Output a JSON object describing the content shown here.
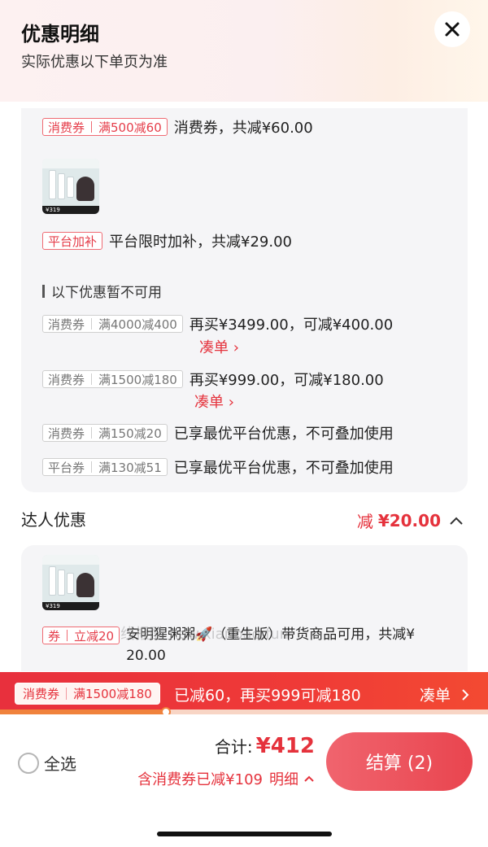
{
  "header": {
    "title": "优惠明细",
    "subtitle": "实际优惠以下单页为准",
    "close_icon": "close-icon"
  },
  "available": {
    "coupon1": {
      "type": "消费券",
      "rule": "满500减60",
      "text": "消费券，共减¥60.00"
    },
    "product_thumb_price": "¥319",
    "coupon2": {
      "type": "平台加补",
      "text": "平台限时加补，共减¥29.00"
    }
  },
  "unavailable": {
    "heading": "以下优惠暂不可用",
    "items": [
      {
        "type": "消费券",
        "rule": "满4000减400",
        "text": "再买¥3499.00，可减¥400.00",
        "link": "凑单"
      },
      {
        "type": "消费券",
        "rule": "满1500减180",
        "text": "再买¥999.00，可减¥180.00",
        "link": "凑单"
      },
      {
        "type": "消费券",
        "rule": "满150减20",
        "text": "已享最优平台优惠，不可叠加使用"
      },
      {
        "type": "平台券",
        "rule": "满130减51",
        "text": "已享最优平台优惠，不可叠加使用"
      }
    ]
  },
  "influencer": {
    "title": "达人优惠",
    "amount_label": "减",
    "amount": "¥20.00",
    "coupon": {
      "type": "券",
      "rule": "立减20",
      "text_line1": "安明猩粥粥🚀（重生版）带货商品可用，共减¥",
      "text_line2": "20.00"
    },
    "product_thumb_price": "¥319"
  },
  "watermark": "线报酷 new.xianbao.fun",
  "banner": {
    "type": "消费券",
    "rule": "满1500减180",
    "text": "已减60，再买999可减180",
    "link": "凑单",
    "progress": 0.34
  },
  "footer": {
    "select_all": "全选",
    "total_label": "合计:",
    "total_value": "¥412",
    "saved_text": "含消费券已减¥109",
    "detail_link": "明细",
    "checkout": "结算 (2)"
  },
  "colors": {
    "accent": "#e5323c",
    "banner": "#ef3a37",
    "card_bg": "#f5f5f7"
  }
}
